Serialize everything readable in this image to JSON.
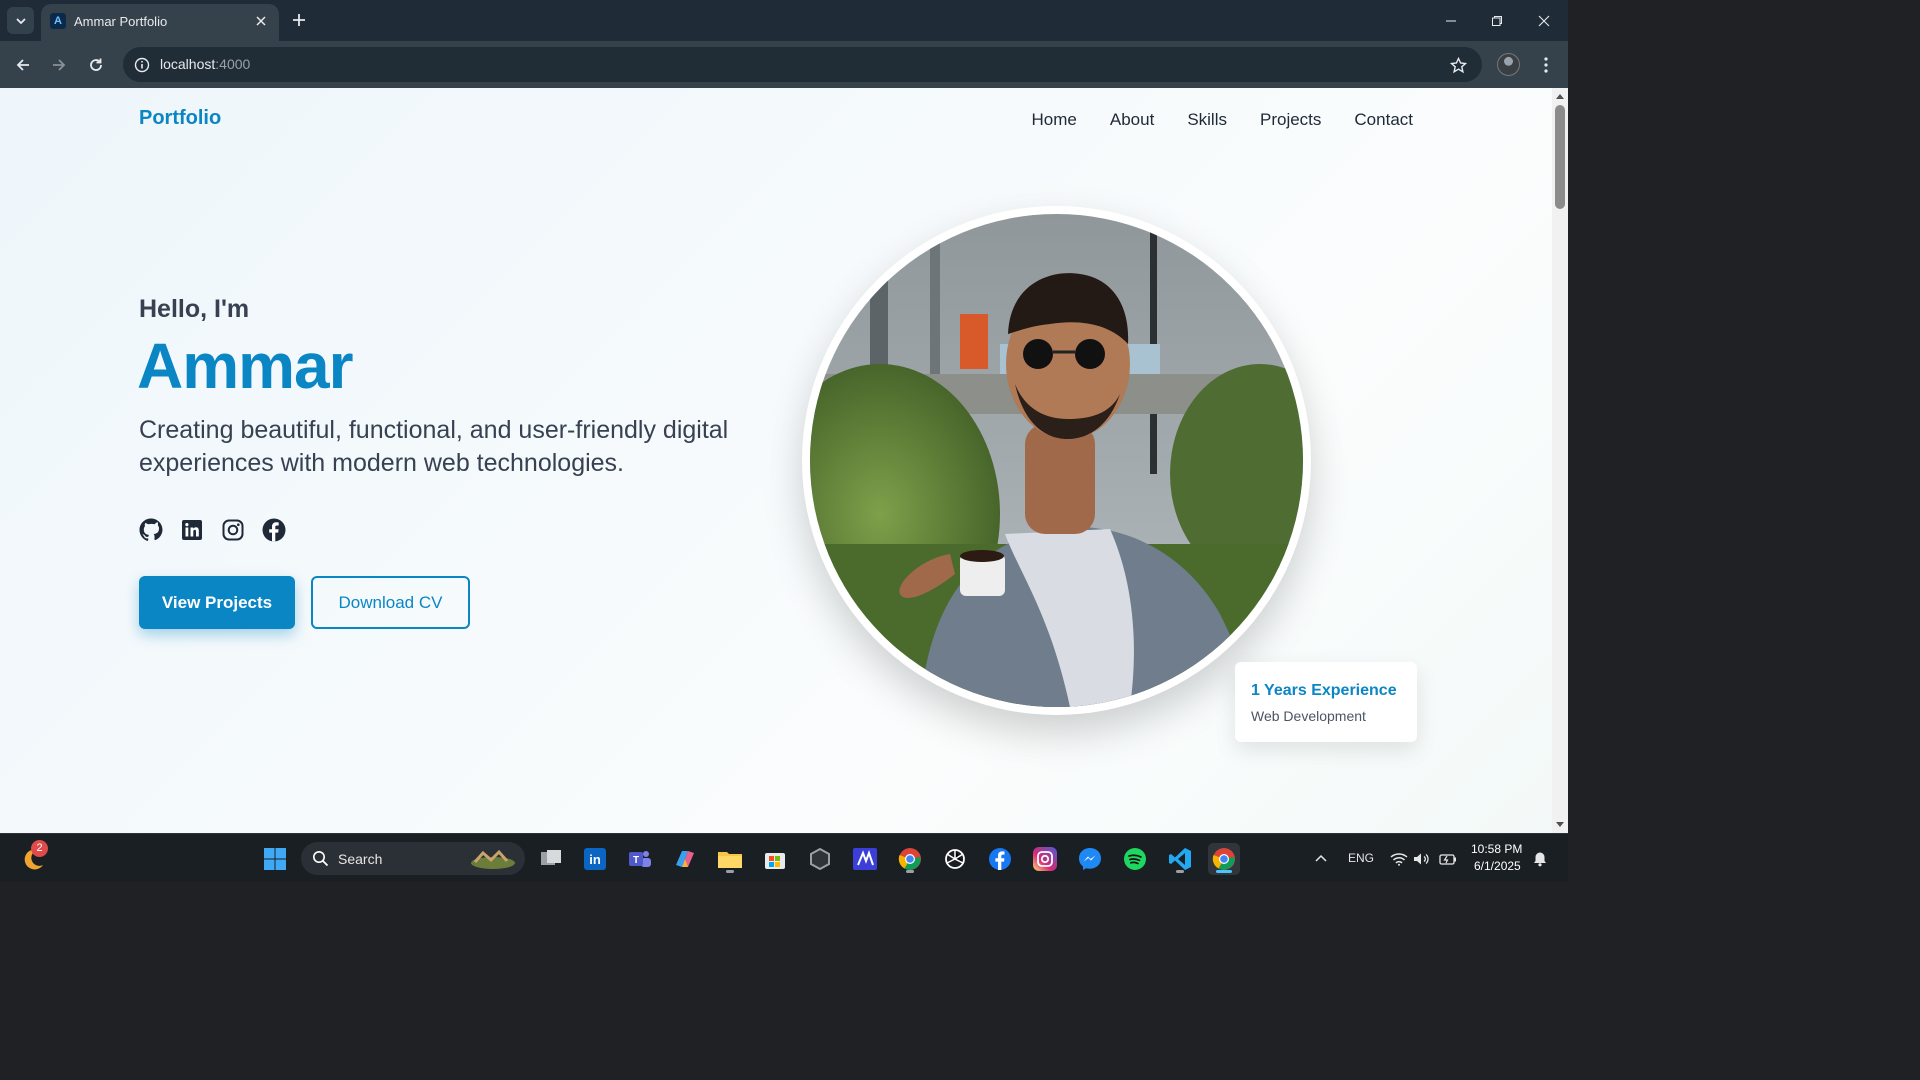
{
  "browser": {
    "tab_title": "Ammar Portfolio",
    "url_host": "localhost",
    "url_port": ":4000"
  },
  "site": {
    "logo": "Portfolio",
    "nav": [
      "Home",
      "About",
      "Skills",
      "Projects",
      "Contact"
    ],
    "hero": {
      "greeting": "Hello, I'm",
      "name": "Ammar",
      "tagline": "Creating beautiful, functional, and user-friendly digital experiences with modern web technologies.",
      "primary_button": "View Projects",
      "secondary_button": "Download CV",
      "socials": [
        "github-icon",
        "linkedin-icon",
        "instagram-icon",
        "facebook-icon"
      ]
    },
    "experience_card": {
      "title": "1 Years Experience",
      "subtitle": "Web Development"
    },
    "accent_color": "#0b86c5"
  },
  "taskbar": {
    "search_label": "Search",
    "notification_count": "2",
    "language": "ENG",
    "time": "10:58 PM",
    "date": "6/1/2025"
  }
}
